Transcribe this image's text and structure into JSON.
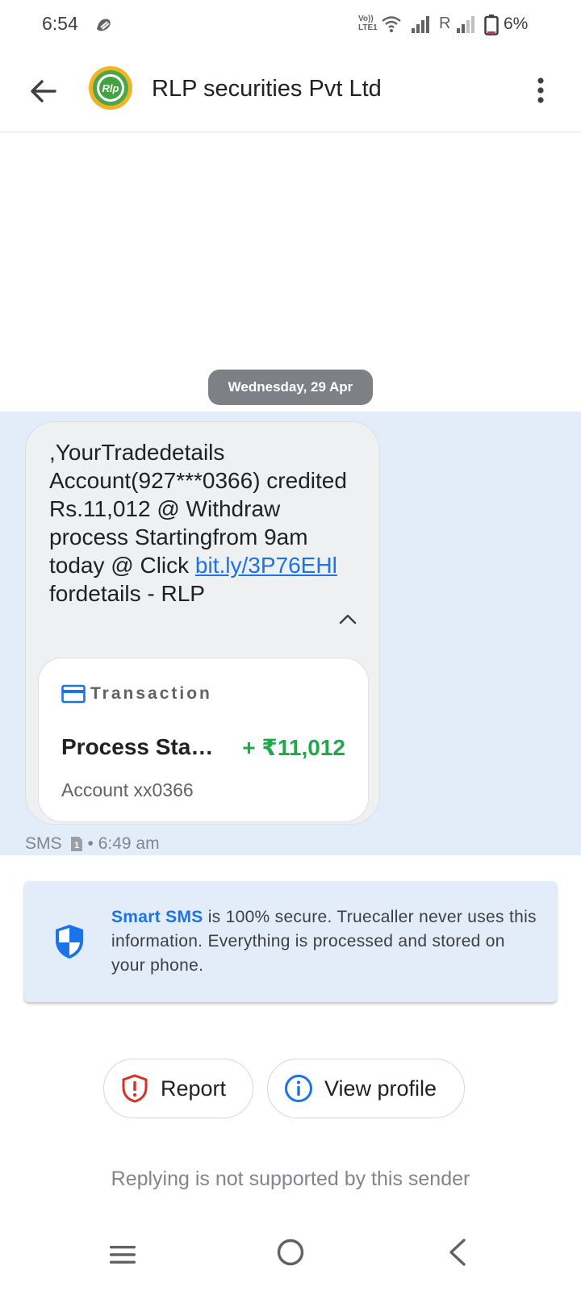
{
  "status_bar": {
    "time": "6:54",
    "volte_line1": "Vo))",
    "volte_line2": "LTE1",
    "roaming": "R",
    "battery": "6%"
  },
  "app_bar": {
    "sender_name": "RLP securities Pvt Ltd",
    "logo_text": "Rlp"
  },
  "date_chip": "Wednesday, 29 Apr",
  "message": {
    "text_before_link": ",YourTradedetails Account(927***0366) credited Rs.11,012 @ Withdraw process Startingfrom 9am today @ Click ",
    "link": "bit.ly/3P76EHl",
    "text_after_link": " fordetails - RLP",
    "transaction": {
      "header": "Transaction",
      "title": "Process Starting",
      "amount": "+ ₹11,012",
      "account": "Account xx0366"
    },
    "meta_type": "SMS",
    "sim": "1",
    "meta_time": "• 6:49 am"
  },
  "smart_sms": {
    "strong": "Smart SMS",
    "text": " is 100% secure. Truecaller never uses this information. Everything is processed and stored on your phone."
  },
  "actions": {
    "report_label": "Report",
    "view_profile_label": "View profile"
  },
  "reply_note": "Replying is not supported by this sender",
  "colors": {
    "accent": "#1a73e8",
    "amount_green": "#1fa84a",
    "report_red": "#d93025",
    "message_area": "#e3edf9"
  }
}
